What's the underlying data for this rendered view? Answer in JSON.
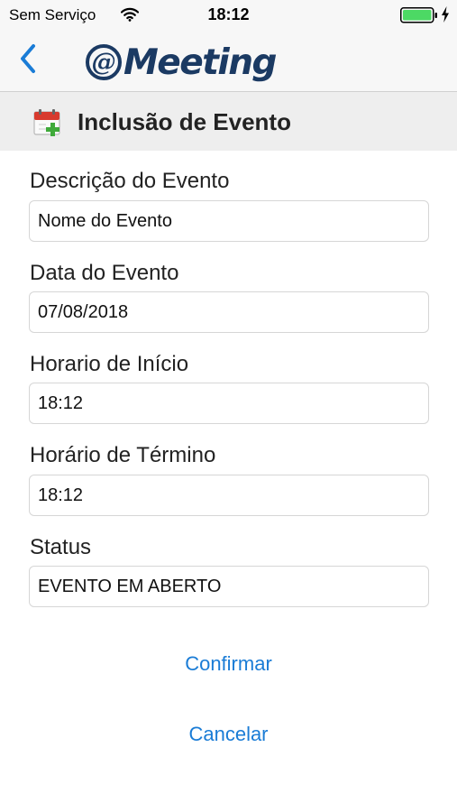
{
  "status_bar": {
    "carrier": "Sem Serviço",
    "time": "18:12",
    "wifi_icon": "wifi-icon",
    "battery_icon": "battery-icon",
    "charging_icon": "charging-bolt-icon",
    "battery_color": "#4cd964"
  },
  "nav": {
    "back_icon": "chevron-left-icon",
    "logo_at": "@",
    "logo_text": "Meeting",
    "logo_color": "#1b3a63",
    "accent_color": "#1a7cd6"
  },
  "section": {
    "icon": "calendar-add-icon",
    "title": "Inclusão de Evento"
  },
  "form": {
    "fields": [
      {
        "label": "Descrição do Evento",
        "value": "Nome do Evento"
      },
      {
        "label": "Data do Evento",
        "value": "07/08/2018"
      },
      {
        "label": "Horario de Início",
        "value": "18:12"
      },
      {
        "label": "Horário de Término",
        "value": "18:12"
      },
      {
        "label": "Status",
        "value": "EVENTO EM ABERTO"
      }
    ]
  },
  "actions": {
    "confirm_label": "Confirmar",
    "cancel_label": "Cancelar"
  }
}
